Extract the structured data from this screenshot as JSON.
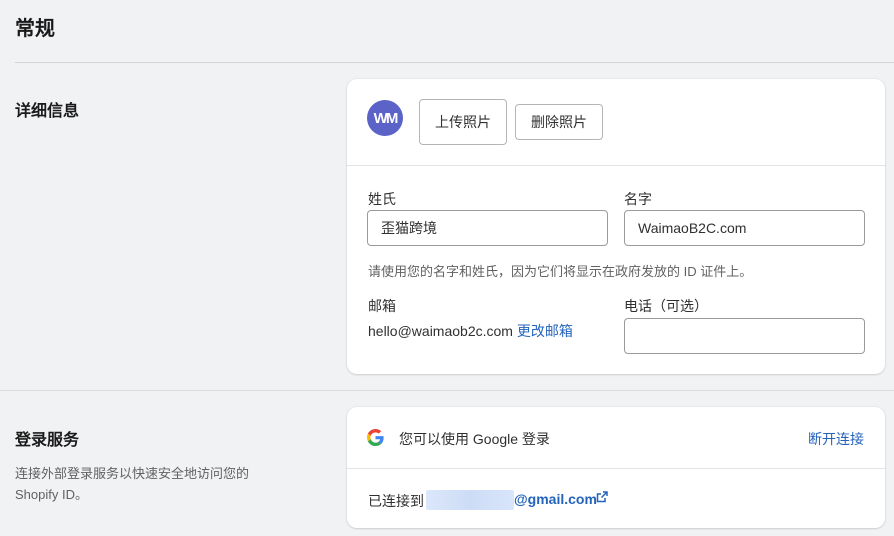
{
  "page": {
    "title": "常规"
  },
  "details": {
    "title": "详细信息",
    "avatar_initials": "WM",
    "upload_label": "上传照片",
    "delete_label": "删除照片",
    "last_name_label": "姓氏",
    "last_name_value": "歪猫跨境",
    "first_name_label": "名字",
    "first_name_value": "WaimaoB2C.com",
    "hint": "请使用您的名字和姓氏，因为它们将显示在政府发放的 ID 证件上。",
    "email_label": "邮箱",
    "email_value": "hello@waimaob2c.com",
    "change_email_label": "更改邮箱",
    "phone_label": "电话（可选）",
    "phone_value": ""
  },
  "login": {
    "title": "登录服务",
    "description": "连接外部登录服务以快速安全地访问您的 Shopify ID。",
    "google_text": "您可以使用 Google 登录",
    "disconnect_label": "断开连接",
    "connected_label": "已连接到",
    "email_suffix": "@gmail.com"
  },
  "colors": {
    "accent": "#2463bc",
    "avatar": "#5b62c8",
    "background": "#f1f2f4"
  }
}
